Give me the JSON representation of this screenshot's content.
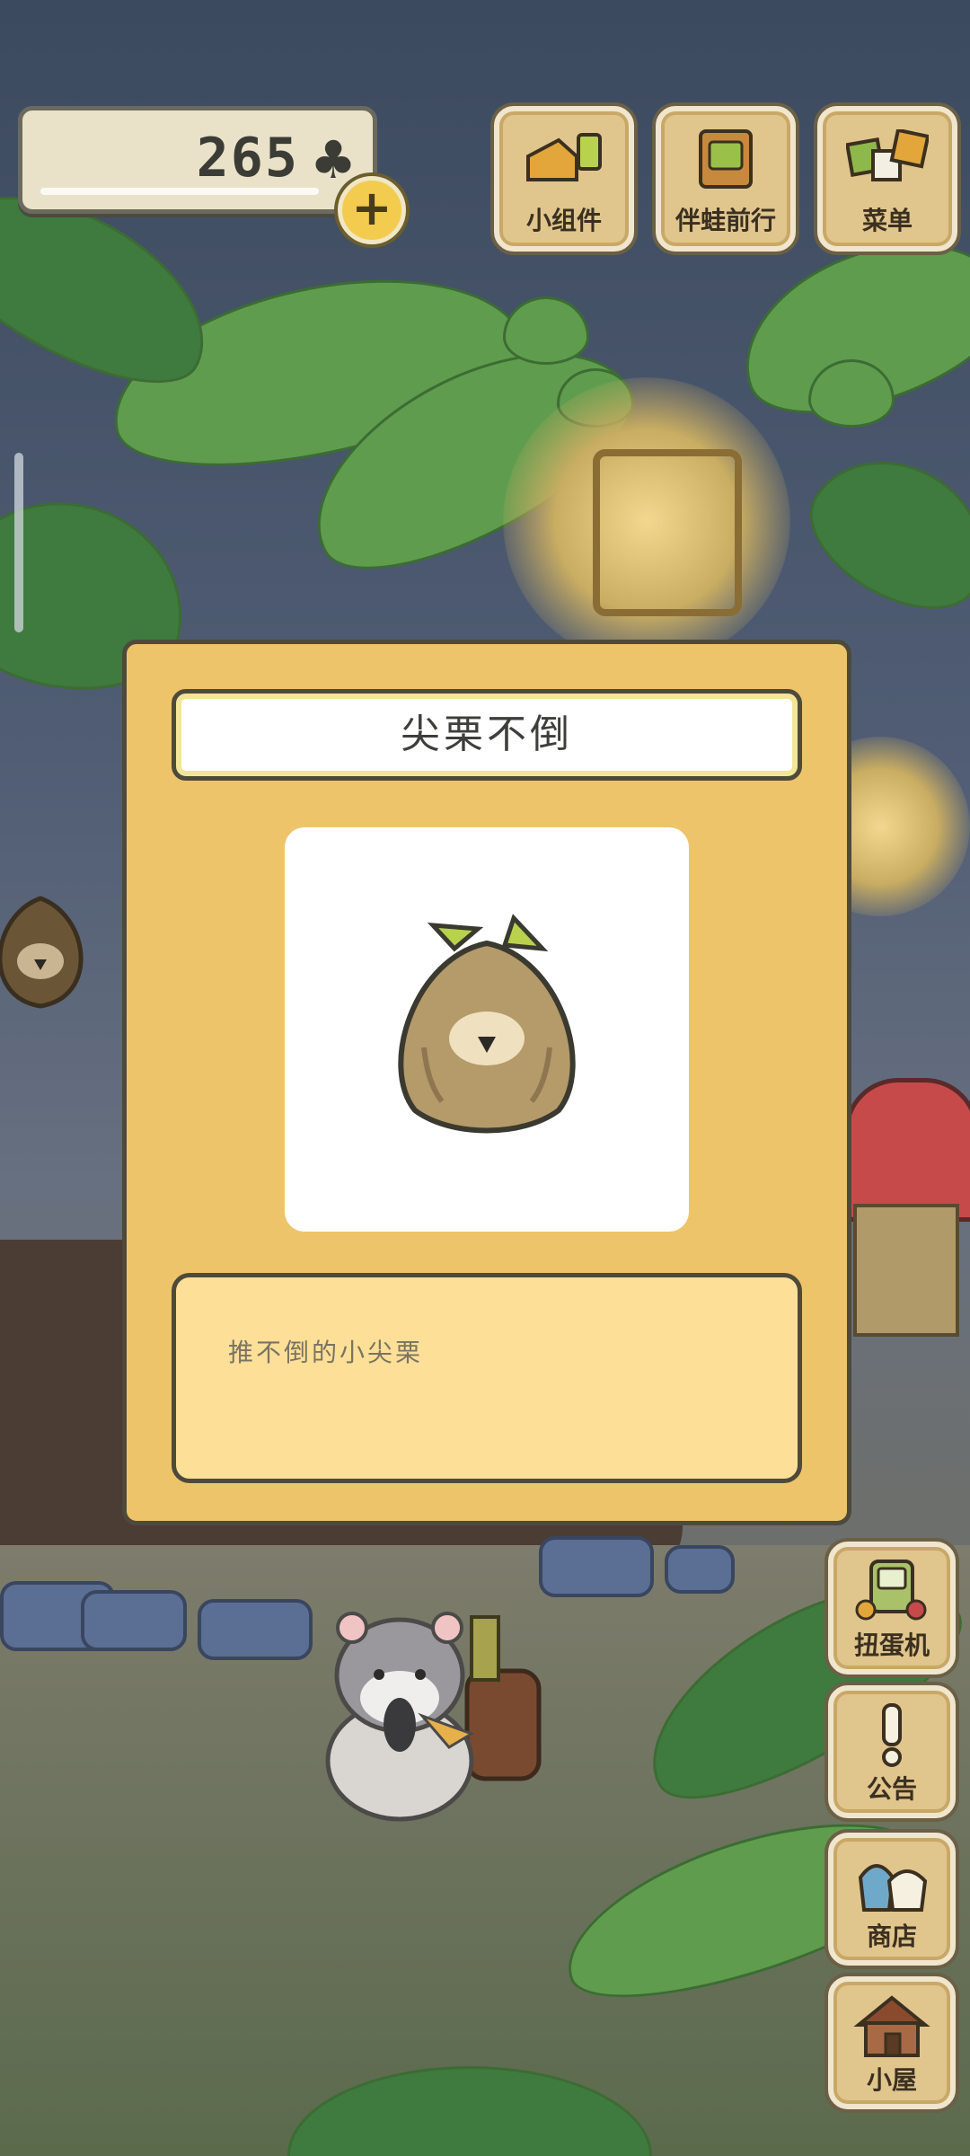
{
  "hud": {
    "clover_count": "265",
    "clover_icon": "clover-icon",
    "add_icon": "plus-icon"
  },
  "top_buttons": [
    {
      "label": "小组件",
      "icon": "widget-icon"
    },
    {
      "label": "伴蛙前行",
      "icon": "journey-book-icon"
    },
    {
      "label": "菜单",
      "icon": "menu-cards-icon"
    }
  ],
  "side_buttons": [
    {
      "label": "扭蛋机",
      "icon": "gacha-machine-icon"
    },
    {
      "label": "公告",
      "icon": "exclamation-icon"
    },
    {
      "label": "商店",
      "icon": "shop-bags-icon"
    },
    {
      "label": "小屋",
      "icon": "house-icon"
    }
  ],
  "card": {
    "title": "尖栗不倒",
    "image_icon": "chestnut-tumbler-icon",
    "description": "推不倒的小尖栗"
  },
  "colors": {
    "card_bg": "#eec46a",
    "desc_bg": "#fedf98",
    "button_bg": "#e0c58d",
    "plus_bg": "#f3cc4f"
  }
}
